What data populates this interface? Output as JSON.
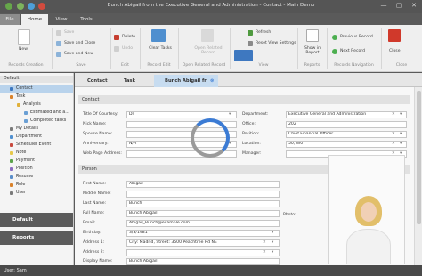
{
  "window": {
    "title": "Bunch Abigail from the Executive General and Administration - Contact - Main Demo",
    "min": "—",
    "max": "▢",
    "close": "✕"
  },
  "tabs": [
    "File",
    "Home",
    "View",
    "Tools"
  ],
  "ribbon": {
    "new": "New",
    "save": "Save",
    "save_close": "Save and Close",
    "save_new": "Save and New",
    "delete": "Delete",
    "undo": "Undo",
    "clear_tasks": "Clear Tasks",
    "open_related": "Open Related Record",
    "refresh": "Refresh",
    "reset_view": "Reset View Settings",
    "show_report": "Show in Report",
    "prev_record": "Previous Record",
    "next_record": "Next Record",
    "close": "Close",
    "groups": [
      "Records Creation",
      "Save",
      "Edit",
      "Record Edit",
      "Open Related Record",
      "View",
      "Reports",
      "Records Navigation",
      "Close"
    ]
  },
  "sidebar": {
    "header": "Default",
    "items": [
      "Contact",
      "Task",
      "Analysis",
      "Estimated and a...",
      "Completed tasks",
      "My Details",
      "Department",
      "Scheduler Event",
      "Note",
      "Payment",
      "Position",
      "Resume",
      "Role",
      "User"
    ],
    "buttons": [
      "Default",
      "Reports"
    ]
  },
  "doc_tabs": [
    "Contact",
    "Task",
    "Bunch Abigail fr"
  ],
  "contact": {
    "section": "Contact",
    "left": [
      {
        "label": "Title Of Courtesy:",
        "value": "Dr"
      },
      {
        "label": "Nick Name:",
        "value": ""
      },
      {
        "label": "Spouse Name:",
        "value": ""
      },
      {
        "label": "Anniversary:",
        "value": "N/A"
      },
      {
        "label": "Web Page Address:",
        "value": ""
      }
    ],
    "right": [
      {
        "label": "Department:",
        "value": "Executive General and Administration"
      },
      {
        "label": "Office:",
        "value": "202"
      },
      {
        "label": "Position:",
        "value": "Chief Financial Officer"
      },
      {
        "label": "Location:",
        "value": "50, W0"
      },
      {
        "label": "Manager:",
        "value": ""
      }
    ]
  },
  "person": {
    "section": "Person",
    "fields": [
      {
        "label": "First Name:",
        "value": "Abigail"
      },
      {
        "label": "Middle Name:",
        "value": ""
      },
      {
        "label": "Last Name:",
        "value": "Bunch"
      },
      {
        "label": "Full Name:",
        "value": "Bunch Abigail"
      },
      {
        "label": "Email:",
        "value": "Abigail_Bunch@example.com"
      },
      {
        "label": "Birthday:",
        "value": "3/3/1981"
      },
      {
        "label": "Address 1:",
        "value": "City: Madrid, Street: 3500 Peachtree Rd NE"
      },
      {
        "label": "Address 2:",
        "value": ""
      },
      {
        "label": "Display Name:",
        "value": "Bunch Abigail"
      }
    ],
    "photo_label": "Photo:"
  },
  "status": {
    "user": "User: Sam"
  },
  "colors": {
    "accent": "#3b7bd4",
    "dark": "#555555"
  }
}
